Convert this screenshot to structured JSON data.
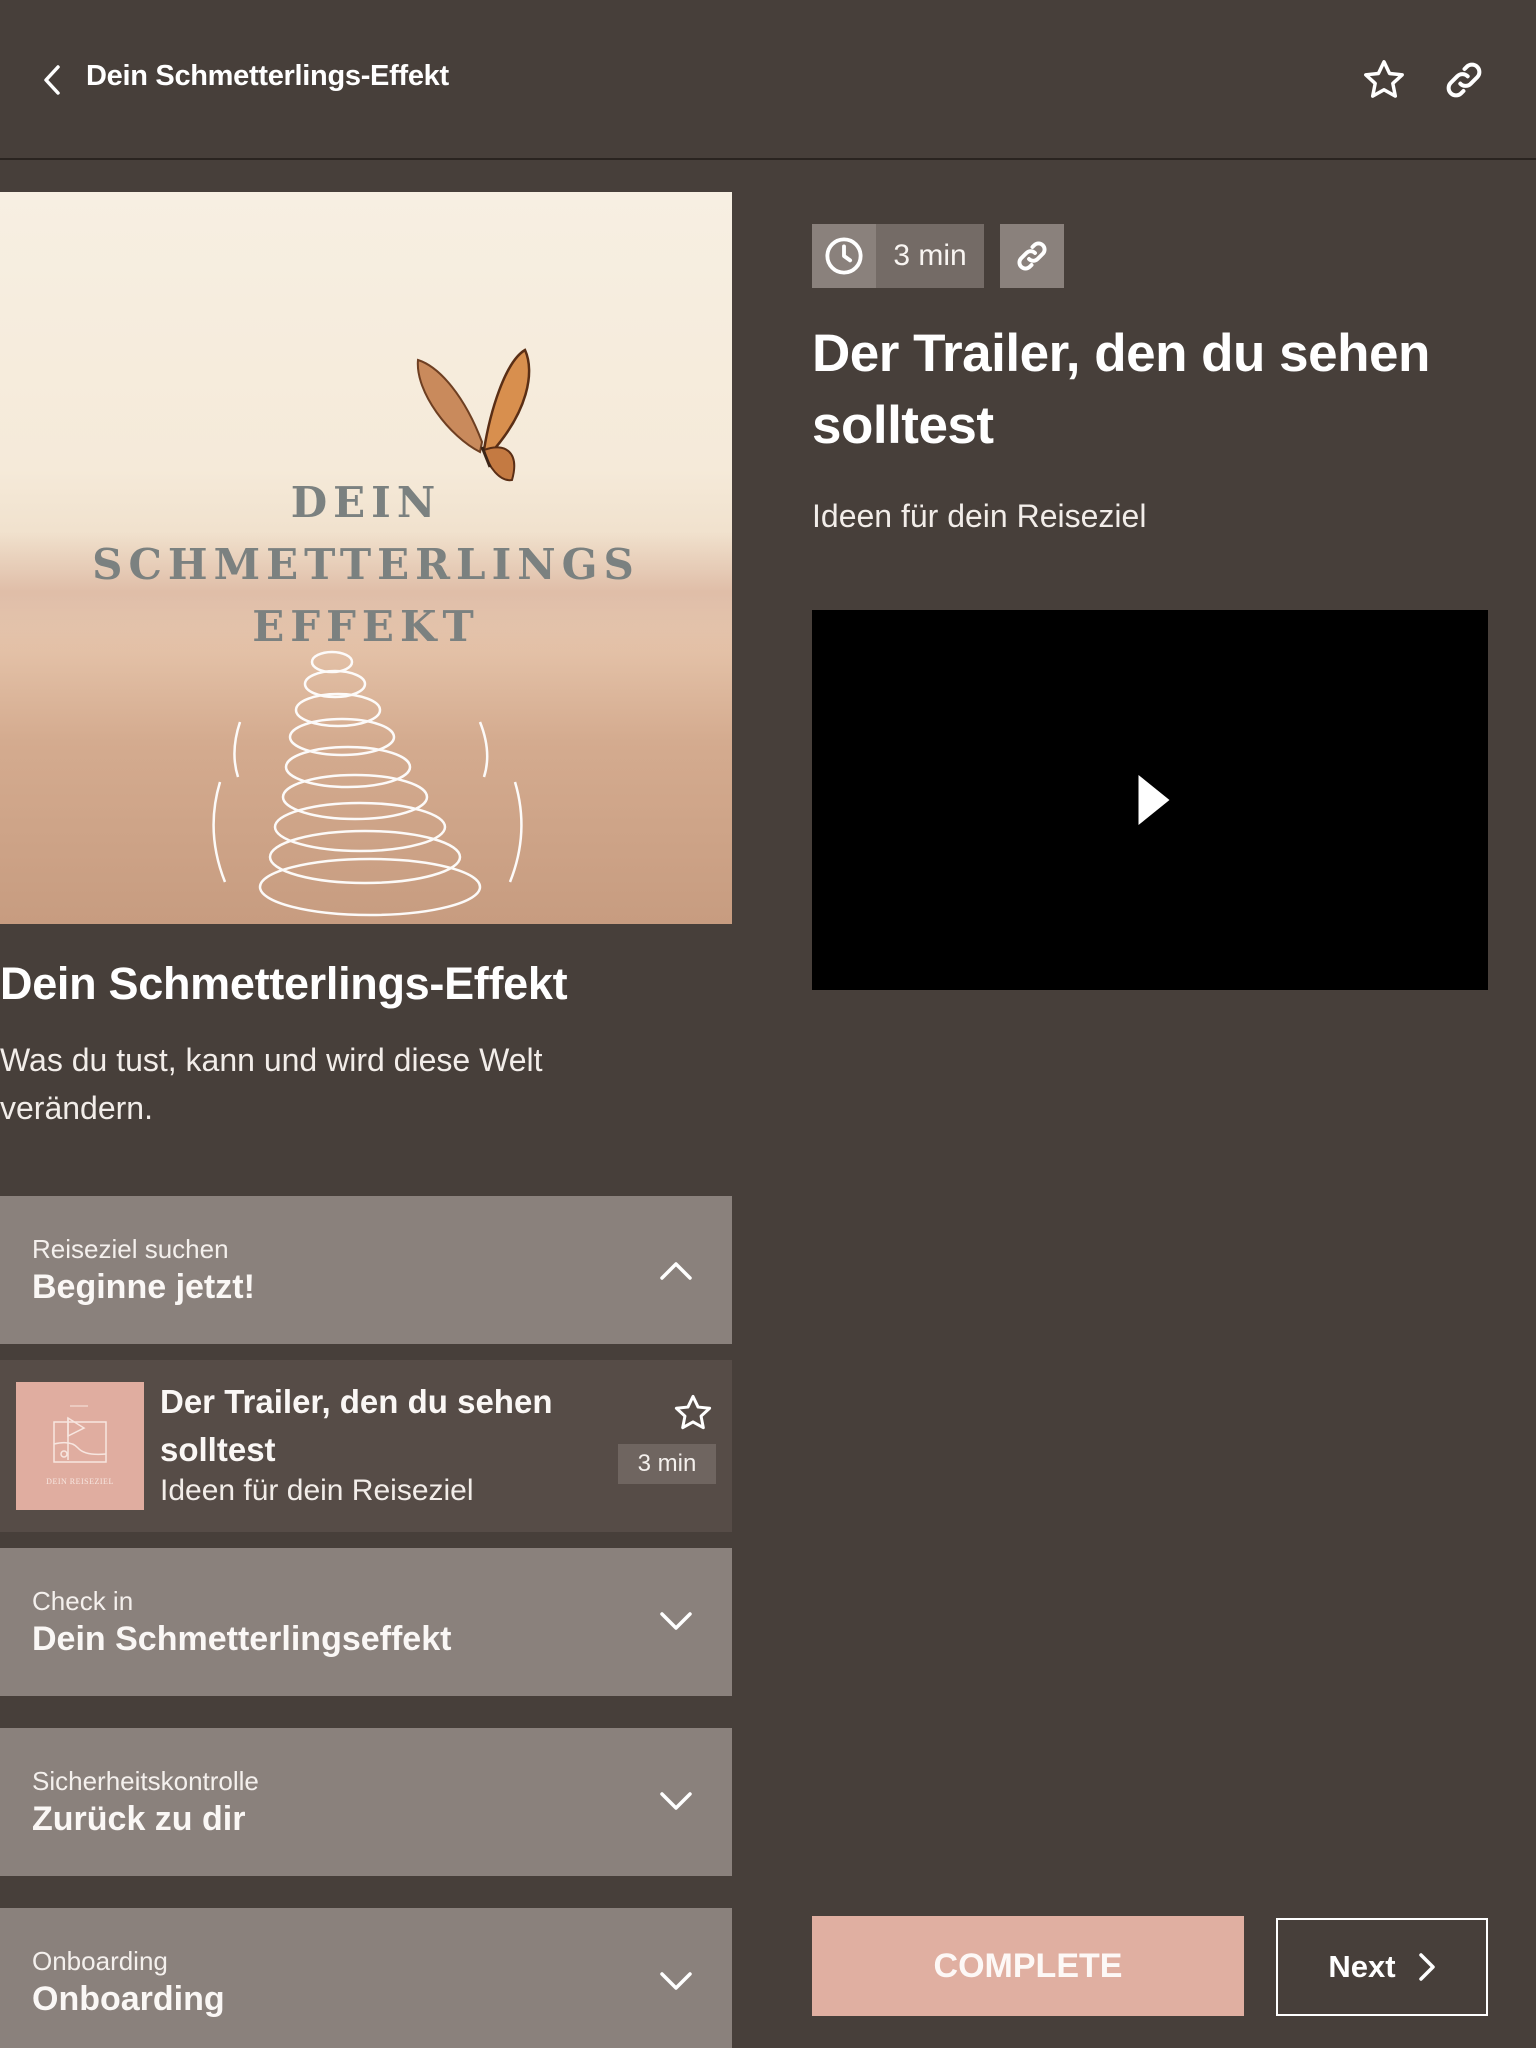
{
  "header": {
    "title": "Dein Schmetterlings-Effekt",
    "back_icon": "chevron-left-icon",
    "favorite_icon": "star-outline-icon",
    "share_icon": "link-icon"
  },
  "course": {
    "cover_text": [
      "DEIN",
      "SCHMETTERLINGS",
      "EFFEKT"
    ],
    "title": "Dein Schmetterlings-Effekt",
    "description": "Was du tust, kann und wird diese Welt verändern."
  },
  "sections": [
    {
      "subtitle": "Reiseziel suchen",
      "title": "Beginne jetzt!",
      "expanded": true
    },
    {
      "subtitle": "Check in",
      "title": "Dein Schmetterlingseffekt",
      "expanded": false
    },
    {
      "subtitle": "Sicherheitskontrolle",
      "title": "Zurück zu dir",
      "expanded": false
    },
    {
      "subtitle": "Onboarding",
      "title": "Onboarding",
      "expanded": false
    }
  ],
  "lesson_item": {
    "thumb_label": "DEIN REISEZIEL",
    "title": "Der Trailer, den du sehen solltest",
    "subtitle": "Ideen für dein Reiseziel",
    "duration": "3 min"
  },
  "lesson": {
    "duration": "3 min",
    "title": "Der Trailer, den du sehen solltest",
    "subtitle": "Ideen für dein Reiseziel"
  },
  "actions": {
    "complete_label": "COMPLETE",
    "next_label": "Next"
  },
  "colors": {
    "background": "#473f3a",
    "section": "#8a817c",
    "lesson_item": "#564c47",
    "accent": "#e0afa1"
  }
}
